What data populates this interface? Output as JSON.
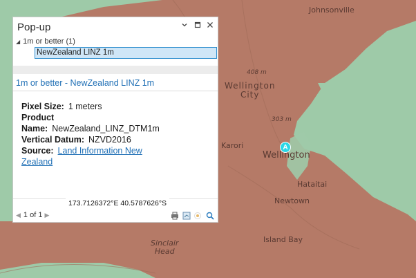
{
  "map": {
    "labels": {
      "johnsonville": "Johnsonville",
      "elev408": "408 m",
      "wellington_city": "Wellington\nCity",
      "elev303": "303 m",
      "karori": "Karori",
      "wellington": "Wellington",
      "hataitai": "Hataitai",
      "newtown": "Newtown",
      "island_bay": "Island Bay",
      "sinclair_head": "Sinclair\nHead"
    },
    "marker_letter": "A",
    "colors": {
      "water": "#9ecaa8",
      "land": "#b57a67",
      "marker": "#2ad7e6"
    }
  },
  "popup": {
    "title": "Pop-up",
    "menu_icon": "chevron-down-icon",
    "tree": {
      "group_label": "1m or better  (1)",
      "selected_item": "NewZealand LINZ 1m"
    },
    "layer_title": "1m or better - NewZealand LINZ 1m",
    "fields": {
      "pixel_size_label": "Pixel Size:",
      "pixel_size_value": "1 meters",
      "product_label_1": "Product",
      "product_label_2": "Name:",
      "product_value": "NewZealand_LINZ_DTM1m",
      "datum_label": "Vertical Datum:",
      "datum_value": "NZVD2016",
      "source_label": "Source:",
      "source_value_1": "Land Information New",
      "source_value_2": "Zealand"
    },
    "coordinates": "173.7126372°E 40.5787626°S",
    "pager": {
      "text": "1 of 1"
    }
  }
}
